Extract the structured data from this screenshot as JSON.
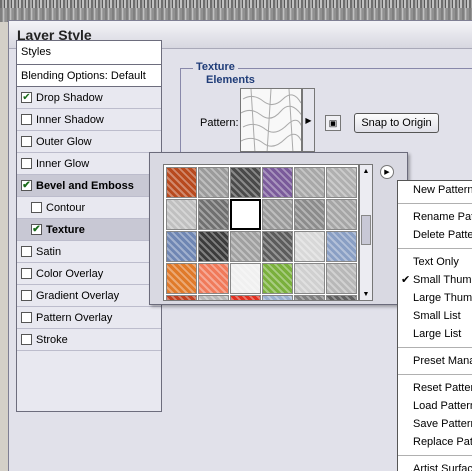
{
  "dialog": {
    "title": "Layer Style"
  },
  "styles_panel": {
    "header": "Styles",
    "blending_options": "Blending Options: Default",
    "items": [
      {
        "label": "Drop Shadow",
        "checked": true,
        "bold": false,
        "sub": false,
        "selected": false
      },
      {
        "label": "Inner Shadow",
        "checked": false,
        "bold": false,
        "sub": false,
        "selected": false
      },
      {
        "label": "Outer Glow",
        "checked": false,
        "bold": false,
        "sub": false,
        "selected": false
      },
      {
        "label": "Inner Glow",
        "checked": false,
        "bold": false,
        "sub": false,
        "selected": false
      },
      {
        "label": "Bevel and Emboss",
        "checked": true,
        "bold": true,
        "sub": false,
        "selected": true
      },
      {
        "label": "Contour",
        "checked": false,
        "bold": false,
        "sub": true,
        "selected": false
      },
      {
        "label": "Texture",
        "checked": true,
        "bold": true,
        "sub": true,
        "selected": true
      },
      {
        "label": "Satin",
        "checked": false,
        "bold": false,
        "sub": false,
        "selected": false
      },
      {
        "label": "Color Overlay",
        "checked": false,
        "bold": false,
        "sub": false,
        "selected": false
      },
      {
        "label": "Gradient Overlay",
        "checked": false,
        "bold": false,
        "sub": false,
        "selected": false
      },
      {
        "label": "Pattern Overlay",
        "checked": false,
        "bold": false,
        "sub": false,
        "selected": false
      },
      {
        "label": "Stroke",
        "checked": false,
        "bold": false,
        "sub": false,
        "selected": false
      }
    ]
  },
  "texture_panel": {
    "section_title": "Texture",
    "subsection_title": "Elements",
    "pattern_label": "Pattern:",
    "snap_button": "Snap to Origin"
  },
  "pattern_picker": {
    "swatch_colors": [
      "#b84a1e",
      "#9b9b9b",
      "#4a4a4a",
      "#7a5a9a",
      "#a8a8a8",
      "#b0b0b0",
      "#c0c0c0",
      "#707070",
      "#ffffff",
      "#9a9a9a",
      "#8c8c8c",
      "#a6a6a6",
      "#6f86b3",
      "#3c3c3c",
      "#a0a0a0",
      "#5c5c5c",
      "#d8d8d8",
      "#8a9fc4",
      "#e07a2a",
      "#f07a5a",
      "#f0f0f0",
      "#7ab03c",
      "#d0d0d0",
      "#b8b8b8",
      "#c04020",
      "#b8b8b8",
      "#e03020",
      "#9ab0d0",
      "#808080",
      "#606060"
    ],
    "selected_index": 8
  },
  "context_menu": {
    "items": [
      {
        "type": "item",
        "label": "New Pattern...",
        "checked": false
      },
      {
        "type": "sep"
      },
      {
        "type": "item",
        "label": "Rename Pattern...",
        "checked": false
      },
      {
        "type": "item",
        "label": "Delete Pattern",
        "checked": false
      },
      {
        "type": "sep"
      },
      {
        "type": "item",
        "label": "Text Only",
        "checked": false
      },
      {
        "type": "item",
        "label": "Small Thumbnail",
        "checked": true
      },
      {
        "type": "item",
        "label": "Large Thumbnail",
        "checked": false
      },
      {
        "type": "item",
        "label": "Small List",
        "checked": false
      },
      {
        "type": "item",
        "label": "Large List",
        "checked": false
      },
      {
        "type": "sep"
      },
      {
        "type": "item",
        "label": "Preset Manager...",
        "checked": false
      },
      {
        "type": "sep"
      },
      {
        "type": "item",
        "label": "Reset Patterns...",
        "checked": false
      },
      {
        "type": "item",
        "label": "Load Patterns...",
        "checked": false
      },
      {
        "type": "item",
        "label": "Save Patterns...",
        "checked": false
      },
      {
        "type": "item",
        "label": "Replace Patterns...",
        "checked": false
      },
      {
        "type": "sep"
      },
      {
        "type": "item",
        "label": "Artist Surfaces",
        "checked": false
      }
    ]
  }
}
